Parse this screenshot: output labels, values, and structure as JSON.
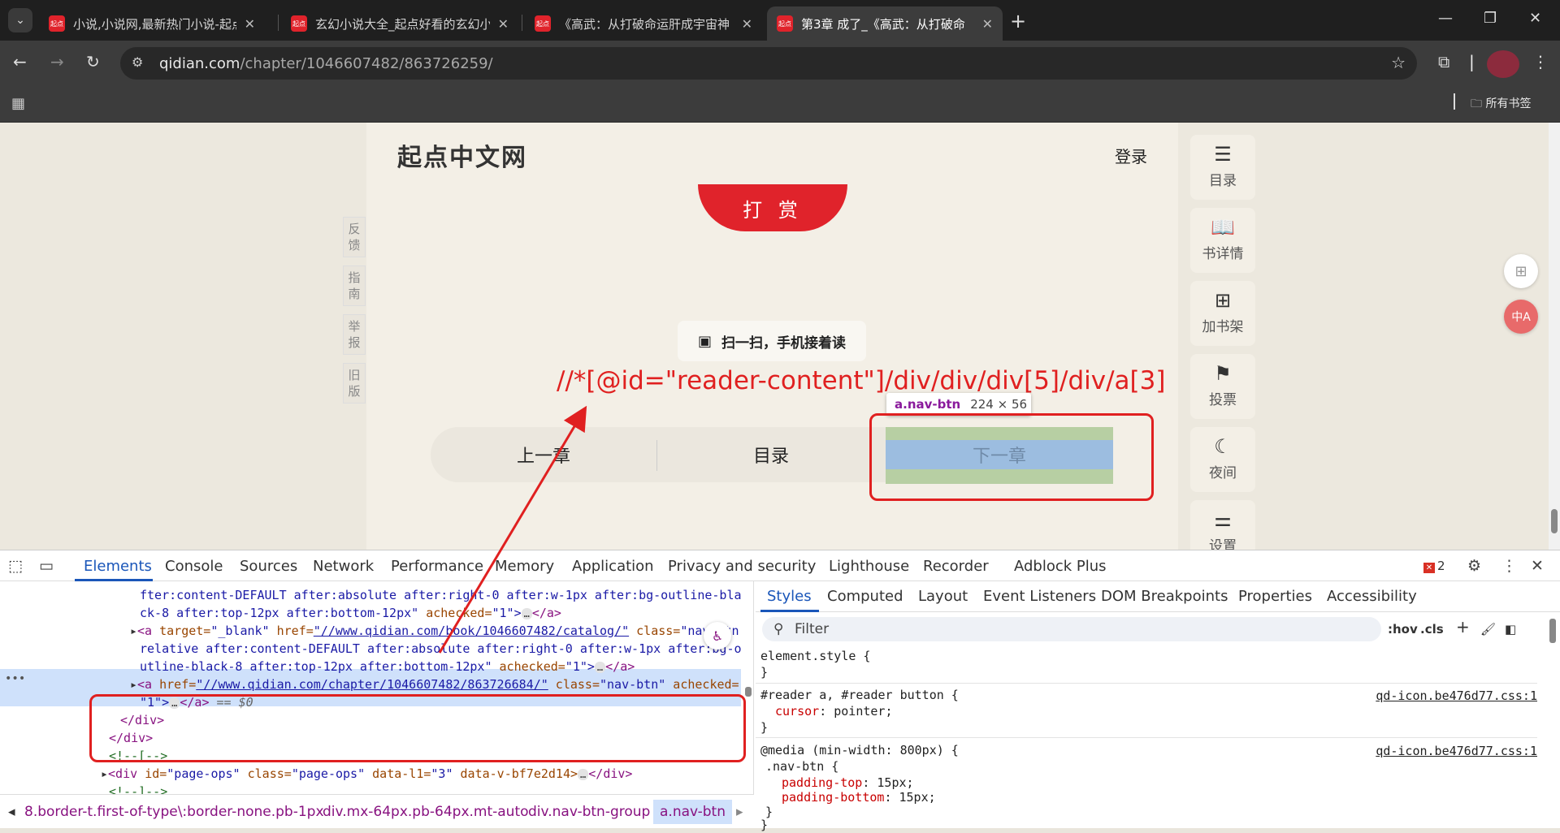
{
  "tabs": [
    {
      "favicon": "起点",
      "title": "小说,小说网,最新热门小说-起点",
      "active": false
    },
    {
      "favicon": "起点",
      "title": "玄幻小说大全_起点好看的玄幻小",
      "active": false
    },
    {
      "favicon": "起点",
      "title": "《高武：从打破命运肝成宇宙神",
      "active": false
    },
    {
      "favicon": "起点",
      "title": "第3章 成了_《高武：从打破命",
      "active": true
    }
  ],
  "address": {
    "host": "qidian.com",
    "path": "/chapter/1046607482/863726259/"
  },
  "bookmarks": {
    "all_label": "所有书签"
  },
  "reader": {
    "brand": "起点中文网",
    "login": "登录",
    "reward": "打 赏",
    "qr_text": "扫一扫，手机接着读",
    "xpath_annotation": "//*[@id=\"reader-content\"]/div/div/div[5]/div/a[3]",
    "nav": {
      "prev": "上一章",
      "catalog": "目录",
      "next": "下一章"
    },
    "tooltip": {
      "tag": "a.nav-btn",
      "size": "224 × 56"
    }
  },
  "feedback": [
    {
      "label": "反\n馈"
    },
    {
      "label": "指\n南"
    },
    {
      "label": "举\n报"
    },
    {
      "label": "旧\n版"
    }
  ],
  "rightbar": [
    {
      "icon": "list-icon",
      "label": "目录"
    },
    {
      "icon": "book-icon",
      "label": "书详情"
    },
    {
      "icon": "bookshelf-add-icon",
      "label": "加书架"
    },
    {
      "icon": "vote-icon",
      "label": "投票"
    },
    {
      "icon": "moon-icon",
      "label": "夜间"
    },
    {
      "icon": "settings-sliders-icon",
      "label": "设置"
    }
  ],
  "devtools": {
    "tabs": [
      "Elements",
      "Console",
      "Sources",
      "Network",
      "Performance",
      "Memory",
      "Application",
      "Privacy and security",
      "Lighthouse",
      "Recorder",
      "Adblock Plus"
    ],
    "error_count": "2",
    "dom_lines": {
      "l1": "fter:content-DEFAULT after:absolute after:right-0 after:w-1px after:bg-outline-bla",
      "l2a": "ck-8 after:top-12px after:bottom-12px\"",
      "l2b": "achecked=",
      "l2c": "\"1\">",
      "l2d": "</a>",
      "l3_open": "<a",
      "l3_target": "target=",
      "l3_target_v": "\"_blank\"",
      "l3_href": "href=",
      "l3_href_v": "\"//www.qidian.com/book/1046607482/catalog/\"",
      "l3_class": "class=",
      "l3_class_v": "\"nav-btn",
      "l4": "relative after:content-DEFAULT after:absolute after:right-0 after:w-1px after:bg-o",
      "l5a": "utline-black-8 after:top-12px after:bottom-12px\"",
      "l5b": "achecked=",
      "l5c": "\"1\">",
      "l5d": "</a>",
      "l6_open": "<a",
      "l6_href": "href=",
      "l6_href_v": "\"//www.qidian.com/chapter/1046607482/863726684/\"",
      "l6_class": "class=",
      "l6_class_v": "\"nav-btn\"",
      "l6_ach": "achecked=",
      "l7a": "\"1\">",
      "l7b": "</a>",
      "l7c": "== $0",
      "l8": "</div>",
      "l9": "</div>",
      "l10": "<!--[-->",
      "l11_open": "<div",
      "l11_id": "id=",
      "l11_id_v": "\"page-ops\"",
      "l11_class": "class=",
      "l11_class_v": "\"page-ops\"",
      "l11_data": "data-l1=",
      "l11_data_v": "\"3\"",
      "l11_v": "data-v-bf7e2d14>",
      "l11_close": "</div>",
      "l12": "<!--]-->"
    },
    "breadcrumbs": [
      "8.border-t.first-of-type\\:border-none.pb-1px",
      "div.mx-64px.pb-64px.mt-auto",
      "div.nav-btn-group",
      "a.nav-btn"
    ],
    "styles_tabs": [
      "Styles",
      "Computed",
      "Layout",
      "Event Listeners",
      "DOM Breakpoints",
      "Properties",
      "Accessibility"
    ],
    "filter_placeholder": "Filter",
    "filter_tools": {
      "hov": ":hov",
      "cls": ".cls"
    },
    "rules": {
      "r1_sel": "element.style {",
      "r1_close": "}",
      "r2_sel": "#reader a, #reader button {",
      "r2_src": "qd-icon.be476d77.css:1",
      "r2_prop": "cursor",
      "r2_val": "pointer;",
      "r2_close": "}",
      "r3_media": "@media (min-width: 800px) {",
      "r3_src": "qd-icon.be476d77.css:1",
      "r3_sel": ".nav-btn {",
      "r3_p1": "padding-top",
      "r3_v1": "15px;",
      "r3_p2": "padding-bottom",
      "r3_v2": "15px;",
      "r3_close": "}",
      "r3_close2": "}"
    }
  },
  "colors": {
    "accent": "#e0232b",
    "devtools_blue": "#1a56b9",
    "annotation_red": "#e02020"
  }
}
